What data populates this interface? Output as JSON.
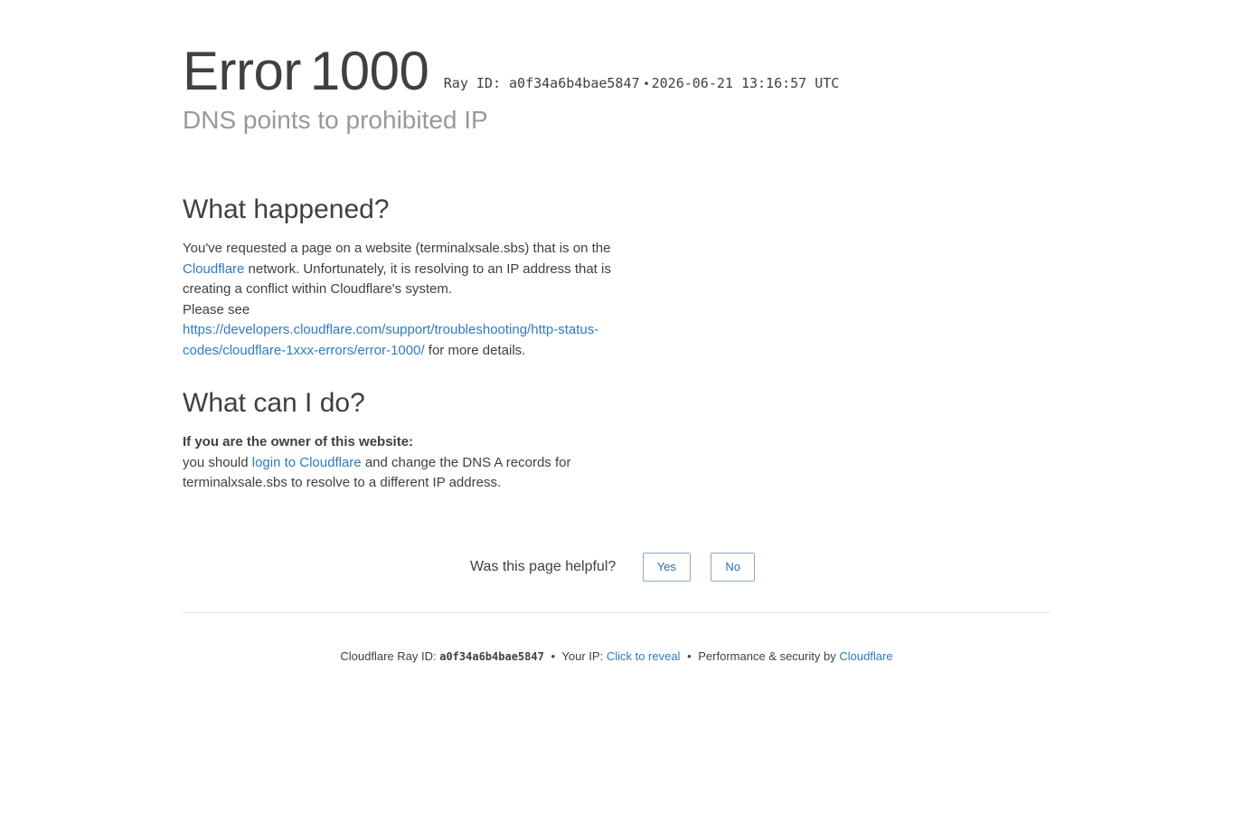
{
  "header": {
    "error_word": "Error",
    "error_code": "1000",
    "ray_label": "Ray ID:",
    "ray_id": "a0f34a6b4bae5847",
    "bullet": "•",
    "timestamp": "2026-06-21 13:16:57 UTC",
    "subtitle": "DNS points to prohibited IP"
  },
  "what_happened": {
    "heading": "What happened?",
    "text_1": "You've requested a page on a website (terminalxsale.sbs) that is on the ",
    "cloudflare_link": "Cloudflare",
    "text_2": " network. Unfortunately, it is resolving to an IP address that is creating a conflict within Cloudflare's system.",
    "please_see": "Please see",
    "docs_link": "https://developers.cloudflare.com/support/troubleshooting/http-status-codes/cloudflare-1xxx-errors/error-1000/",
    "more_details": " for more details."
  },
  "what_can_i_do": {
    "heading": "What can I do?",
    "owner_label": "If you are the owner of this website:",
    "text_1": "you should ",
    "login_link": "login to Cloudflare",
    "text_2": " and change the DNS A records for terminalxsale.sbs to resolve to a different IP address."
  },
  "feedback": {
    "question": "Was this page helpful?",
    "yes_label": "Yes",
    "no_label": "No"
  },
  "footer": {
    "ray_label": "Cloudflare Ray ID:",
    "ray_id": "a0f34a6b4bae5847",
    "bullet": "•",
    "ip_label": "Your IP:",
    "reveal_link": "Click to reveal",
    "perf_text": "Performance & security by",
    "cloudflare_link": "Cloudflare"
  },
  "colors": {
    "link": "#2f7bbf",
    "text": "#404040",
    "muted": "#999999"
  }
}
